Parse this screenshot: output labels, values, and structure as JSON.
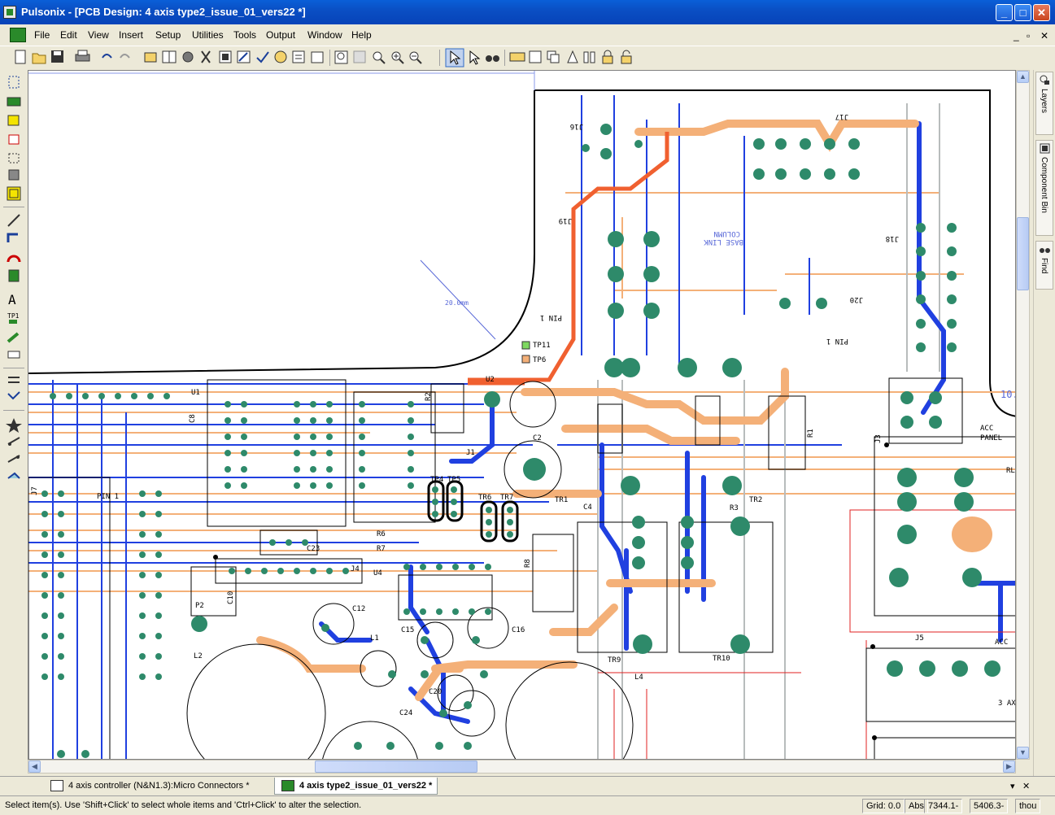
{
  "window": {
    "app_name": "Pulsonix",
    "title": "Pulsonix - [PCB Design: 4 axis type2_issue_01_vers22 *]",
    "minimize": "_",
    "maximize": "□",
    "close": "✕"
  },
  "menu": {
    "items": [
      "File",
      "Edit",
      "View",
      "Insert",
      "Setup",
      "Utilities",
      "Tools",
      "Output",
      "Window",
      "Help"
    ],
    "mdi_controls": [
      "_",
      "▫",
      "✕"
    ]
  },
  "toolbar": {
    "icons": [
      "new-icon",
      "open-icon",
      "save-icon",
      "print-icon",
      "undo-icon",
      "redo-icon",
      "component-icon",
      "library-icon",
      "settings-icon",
      "net-icon",
      "board-icon",
      "route-icon",
      "check-icon",
      "report-icon",
      "properties-icon",
      "zoom-all-icon",
      "zoom-window-icon",
      "zoom-previous-icon",
      "zoom-in-icon",
      "zoom-out-icon",
      "select-icon",
      "select-item-icon",
      "binocular-icon",
      "ruler-icon",
      "layer-icon",
      "copy-icon",
      "align-icon",
      "pad-icon",
      "lock-icon",
      "unlock-icon"
    ]
  },
  "left_toolbar": {
    "icons": [
      "select-rect-icon",
      "component-place-icon",
      "area-icon",
      "board-outline-icon",
      "dotted-area-icon",
      "keepout-icon",
      "shape-icon",
      "line-icon",
      "route-track-icon",
      "via-icon",
      "pad-place-icon",
      "text-icon",
      "testpoint-icon",
      "measure-icon",
      "drc-icon",
      "align-icon",
      "swap-icon",
      "star-icon",
      "gate-swap-icon",
      "pin-swap-icon"
    ],
    "text_tool": "A",
    "testpoint_label": "TP1"
  },
  "right_panel": {
    "tabs": [
      {
        "label": "Layers",
        "icon": "layers-icon"
      },
      {
        "label": "Component Bin",
        "icon": "component-bin-icon"
      },
      {
        "label": "Find",
        "icon": "binocular-icon"
      }
    ]
  },
  "canvas": {
    "dimension_label": "20.0mm",
    "labels": [
      "J16",
      "J17",
      "J19",
      "J18",
      "J20",
      "PIN 1",
      "PIN 1",
      "COLUMN",
      "BASE LINK",
      "TP11",
      "TP6",
      "U2",
      "C2",
      "J1",
      "U1",
      "J3",
      "R1",
      "R2",
      "ACC",
      "PANEL",
      "RL",
      "TR1",
      "TR2",
      "R3",
      "C4",
      "TR6",
      "TR7",
      "TP4",
      "TP5",
      "R6",
      "R7",
      "C8",
      "C23",
      "J4",
      "U4",
      "R8",
      "C12",
      "L1",
      "C15",
      "C16",
      "C20",
      "C24",
      "L2",
      "P2",
      "C10",
      "TR9",
      "TR10",
      "L4",
      "J5",
      "3 AX",
      "ACC",
      "PIN 1",
      "J7",
      "10."
    ]
  },
  "doc_tabs": [
    {
      "label": "4 axis controller (N&N1.3):Micro Connectors *",
      "active": false
    },
    {
      "label": "4 axis type2_issue_01_vers22 *",
      "active": true
    }
  ],
  "doc_tab_controls": [
    "▾",
    "✕"
  ],
  "status": {
    "message": "Select item(s). Use 'Shift+Click' to select whole items and 'Ctrl+Click' to alter the selection.",
    "grid": "Grid: 0.0",
    "abs": "Abs",
    "x": "7344.1-",
    "y": "5406.3-",
    "units": "thou"
  },
  "colors": {
    "title_bar": "#0a4fc4",
    "track_blue": "#2040e0",
    "track_orange": "#f4b078",
    "track_red": "#f06030",
    "pad_green": "#2e8a6a",
    "outline": "#000000"
  }
}
